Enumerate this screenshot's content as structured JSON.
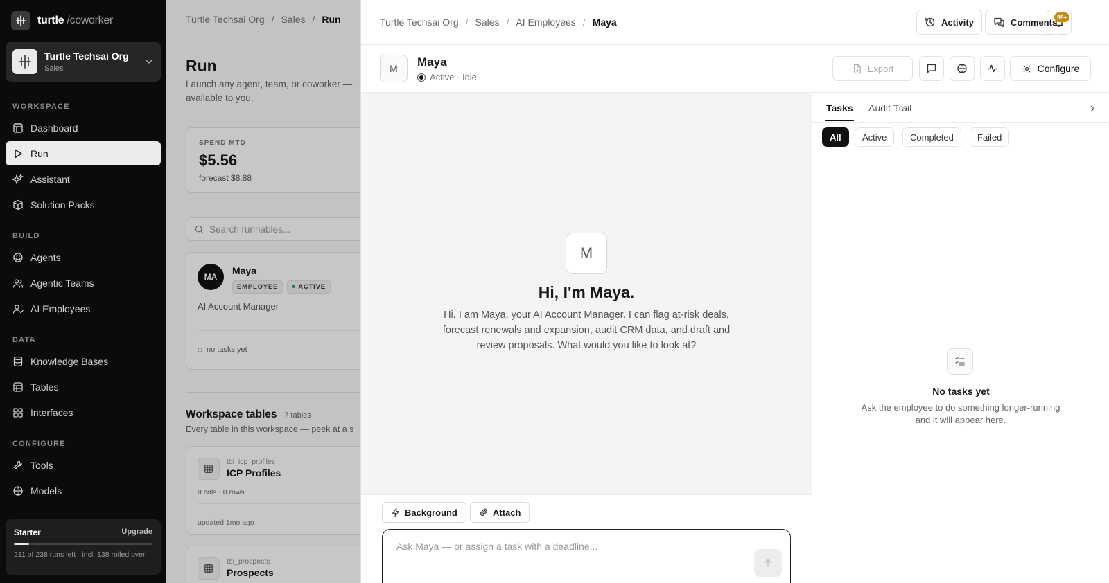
{
  "sidebar": {
    "logo": {
      "brand": "turtle",
      "product": "/coworker"
    },
    "org": {
      "name": "Turtle Techsai Org",
      "sub": "Sales"
    },
    "sections": {
      "workspace": "WORKSPACE",
      "build": "BUILD",
      "data": "DATA",
      "configure": "CONFIGURE"
    },
    "items": {
      "dashboard": "Dashboard",
      "run": "Run",
      "assistant": "Assistant",
      "solution_packs": "Solution Packs",
      "agents": "Agents",
      "agentic_teams": "Agentic Teams",
      "ai_employees": "AI Employees",
      "knowledge_bases": "Knowledge Bases",
      "tables": "Tables",
      "interfaces": "Interfaces",
      "tools": "Tools",
      "models": "Models"
    },
    "plan": {
      "name": "Starter",
      "upgrade": "Upgrade",
      "text": "211 of 238 runs left · incl. 138 rolled over",
      "used_fraction": 0.11
    }
  },
  "page": {
    "breadcrumb": [
      "Turtle Techsai Org",
      "/",
      "Sales",
      "/",
      "Run"
    ],
    "title": "Run",
    "description": "Launch any agent, team, or coworker — available to you.",
    "spend": {
      "label": "SPEND MTD",
      "value": "$5.56",
      "forecast": "forecast $8.88"
    },
    "search_placeholder": "Search runnables...",
    "agent_card": {
      "initials": "MA",
      "name": "Maya",
      "badge_type": "EMPLOYEE",
      "badge_status": "ACTIVE",
      "role": "AI Account Manager",
      "tasks": "no tasks yet"
    },
    "workspace_tables": {
      "title": "Workspace tables",
      "count": "· 7 tables",
      "description": "Every table in this workspace — peek at a s"
    },
    "tables": [
      {
        "id": "tbl_icp_profiles",
        "name": "ICP Profiles",
        "meta": "9 cols · 0 rows",
        "updated": "updated 1mo ago"
      },
      {
        "id": "tbl_prospects",
        "name": "Prospects"
      }
    ]
  },
  "panel": {
    "breadcrumb": [
      "Turtle Techsai Org",
      "Sales",
      "AI Employees",
      "Maya"
    ],
    "activity_label": "Activity",
    "comments_label": "Comments",
    "notifications_badge": "99+",
    "employee": {
      "initial": "M",
      "name": "Maya",
      "status": "Active · Idle"
    },
    "export_label": "Export",
    "configure_label": "Configure",
    "chat": {
      "greeting": "Hi, I'm Maya.",
      "intro": "Hi, I am Maya, your AI Account Manager. I can flag at-risk deals, forecast renewals and expansion, audit CRM data, and draft and review proposals. What would you like to look at?",
      "background_label": "Background",
      "attach_label": "Attach",
      "input_placeholder": "Ask Maya — or assign a task with a deadline...",
      "input_value": ""
    },
    "tabs": {
      "tasks": "Tasks",
      "audit_trail": "Audit Trail"
    },
    "filters": {
      "all": "All",
      "active": "Active",
      "completed": "Completed",
      "failed": "Failed"
    },
    "empty": {
      "title": "No tasks yet",
      "description": "Ask the employee to do something longer-running and it will appear here."
    }
  },
  "colors": {
    "sidebar_bg": "#0b0b0b",
    "accent": "#111111",
    "badge_notification": "#c58a12",
    "status_active": "#22a55a"
  }
}
